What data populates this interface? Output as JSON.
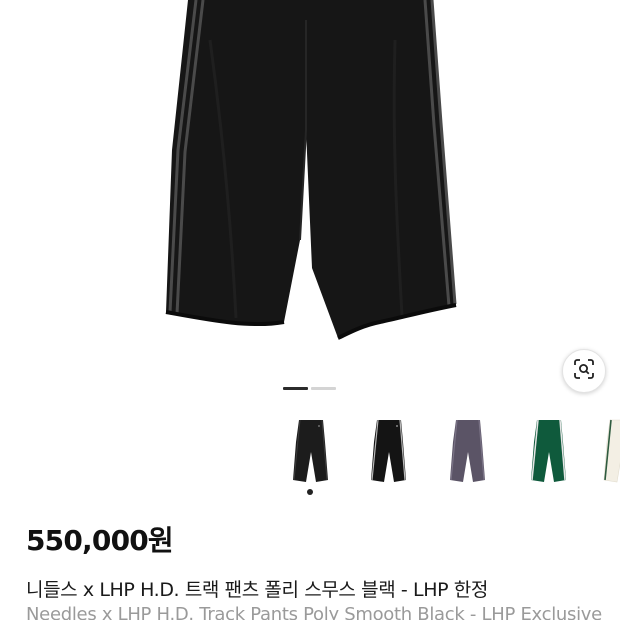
{
  "gallery": {
    "pager_total": 2,
    "pager_active": 1,
    "lens_icon": "image-search-icon"
  },
  "thumbnails": [
    {
      "color": "#1c1c1c",
      "stripe": "#3b3b3b",
      "label": "black"
    },
    {
      "color": "#141414",
      "stripe": "#b9b9b9",
      "label": "black-grey-stripe"
    },
    {
      "color": "#5b5466",
      "stripe": "#7a7386",
      "label": "purple-grey"
    },
    {
      "color": "#0f5a3c",
      "stripe": "#e6e6e6",
      "label": "green"
    },
    {
      "color": "#f3efe4",
      "stripe": "#2e5b3f",
      "label": "ivory"
    }
  ],
  "product": {
    "price": "550,000원",
    "title_ko": "니들스 x LHP H.D. 트랙 팬츠 폴리 스무스 블랙 - LHP 한정",
    "title_en": "Needles x LHP H.D. Track Pants Poly Smooth Black - LHP Exclusive"
  }
}
